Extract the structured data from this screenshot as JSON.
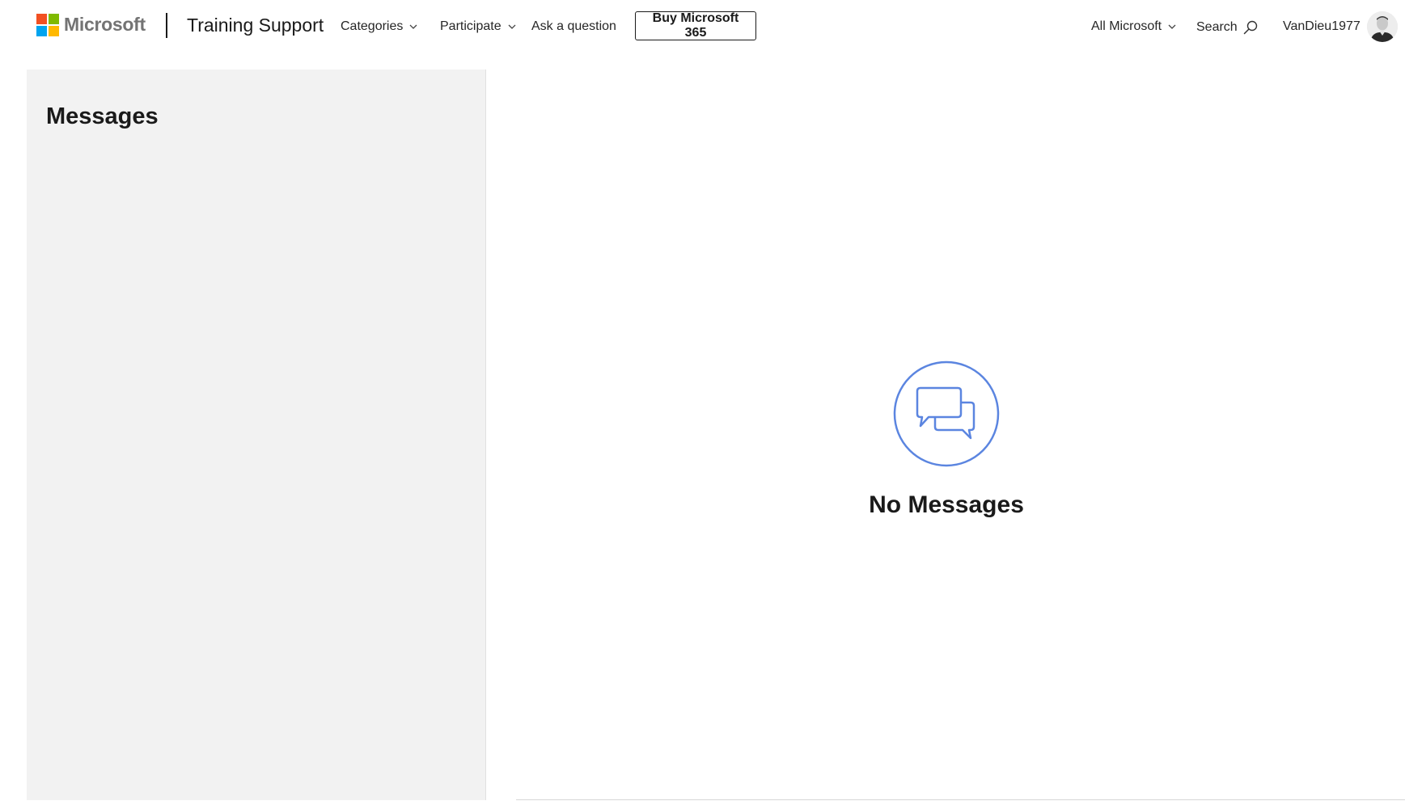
{
  "header": {
    "logo_text": "Microsoft",
    "logo_colors": [
      "#f25022",
      "#7fba00",
      "#00a4ef",
      "#ffb900"
    ],
    "site_title": "Training Support",
    "nav": {
      "categories": "Categories",
      "participate": "Participate",
      "ask": "Ask a question",
      "buy": "Buy Microsoft 365"
    },
    "right": {
      "all_microsoft": "All Microsoft",
      "search": "Search",
      "username": "VanDieu1977"
    },
    "icons": {
      "chevron": "chevron-down-icon",
      "search": "search-icon",
      "avatar": "user-avatar"
    }
  },
  "sidebar": {
    "title": "Messages",
    "background": "#f2f2f2"
  },
  "main": {
    "empty_icon": "chat-bubbles-icon",
    "empty_icon_color": "#5b85e0",
    "empty_text": "No Messages"
  }
}
